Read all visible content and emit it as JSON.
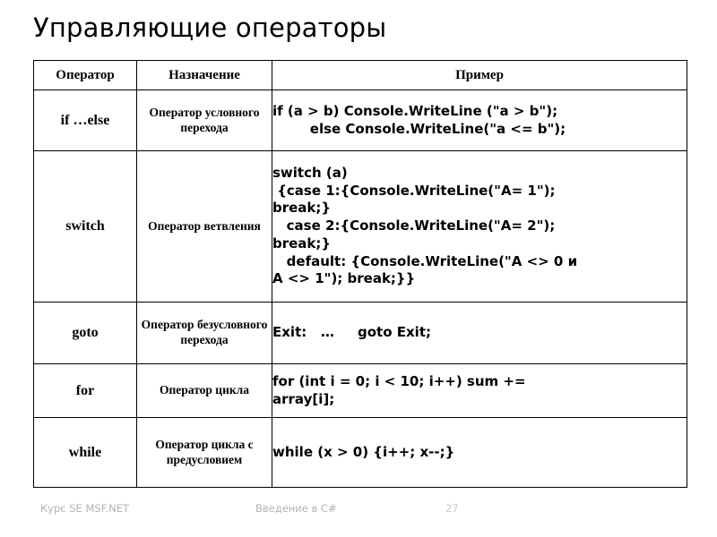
{
  "slide": {
    "title": "Управляющие операторы"
  },
  "table": {
    "headers": {
      "operator": "Оператор",
      "purpose": "Назначение",
      "example": "Пример"
    },
    "rows": [
      {
        "operator": "if …else",
        "purpose": "Оператор\nусловного\nперехода",
        "example": "if (a > b) Console.WriteLine (\"a > b\");\n        else Console.WriteLine(\"a <= b\");"
      },
      {
        "operator": "switch",
        "purpose": "Оператор\nветвления",
        "example": "switch (a)\n {case 1:{Console.WriteLine(\"A= 1\");\nbreak;}\n   case 2:{Console.WriteLine(\"A= 2\");\nbreak;}\n   default: {Console.WriteLine(\"A <> 0 и\nA <> 1\"); break;}}"
      },
      {
        "operator": "goto",
        "purpose": "Оператор\nбезусловного\nперехода",
        "example": "Exit:   …     goto Exit;"
      },
      {
        "operator": "for",
        "purpose": "Оператор\nцикла",
        "example": "for (int i = 0; i < 10; i++) sum +=\narray[i];"
      },
      {
        "operator": "while",
        "purpose": "Оператор\nцикла с\nпредусловием",
        "example": "while (x > 0) {i++; x--;}"
      }
    ]
  },
  "footer": {
    "course": "Курс SE MSF.NET",
    "subject": "Введение в C#",
    "page_number": "27"
  },
  "colors": {
    "text": "#000000",
    "background": "#ffffff",
    "border": "#000000",
    "footer_text": "#b3b3b3"
  }
}
